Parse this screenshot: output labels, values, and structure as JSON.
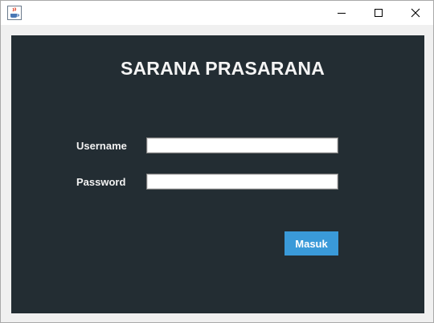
{
  "window": {
    "icon": "java-cup-icon",
    "controls": [
      "minimize-icon",
      "maximize-icon",
      "close-icon"
    ]
  },
  "form": {
    "title": "SARANA PRASARANA",
    "username_label": "Username",
    "username_value": "",
    "password_label": "Password",
    "password_value": "",
    "submit_label": "Masuk"
  },
  "colors": {
    "panel_background": "#232d33",
    "button_accent": "#3a9ad9",
    "window_frame": "#f0f0f0"
  }
}
